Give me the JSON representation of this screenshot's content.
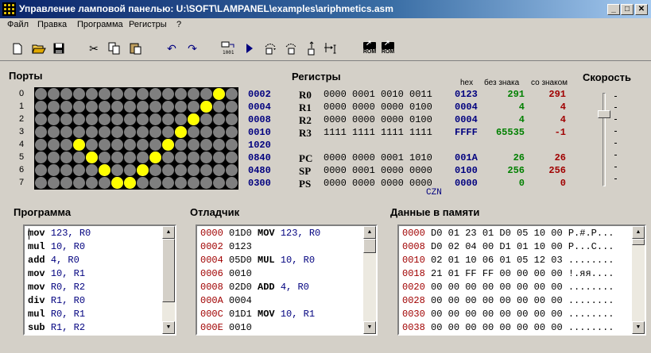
{
  "window": {
    "title": "Управление ламповой панелью: U:\\SOFT\\LAMPANEL\\examples\\ariphmetics.asm",
    "min": "_",
    "max": "□",
    "close": "✕"
  },
  "menu": [
    "Файл",
    "Правка",
    "Программа",
    "Регистры",
    "?"
  ],
  "toolbar": {
    "icons": [
      "new-file-icon",
      "open-folder-icon",
      "save-icon",
      "cut-icon",
      "copy-icon",
      "paste-icon",
      "undo-icon",
      "redo-icon",
      "compile-icon",
      "run-icon",
      "step-into-icon",
      "step-over-icon",
      "step-out-icon",
      "run-to-cursor-icon",
      "load-rom-icon",
      "save-rom-icon"
    ],
    "rom_labels": [
      "ROM",
      "ROM"
    ]
  },
  "ports": {
    "title": "Порты",
    "rows": [
      {
        "num": "0",
        "value": "0002",
        "bits": [
          0,
          0,
          0,
          0,
          0,
          0,
          0,
          0,
          0,
          0,
          0,
          0,
          0,
          0,
          1,
          0
        ]
      },
      {
        "num": "1",
        "value": "0004",
        "bits": [
          0,
          0,
          0,
          0,
          0,
          0,
          0,
          0,
          0,
          0,
          0,
          0,
          0,
          1,
          0,
          0
        ]
      },
      {
        "num": "2",
        "value": "0008",
        "bits": [
          0,
          0,
          0,
          0,
          0,
          0,
          0,
          0,
          0,
          0,
          0,
          0,
          1,
          0,
          0,
          0
        ]
      },
      {
        "num": "3",
        "value": "0010",
        "bits": [
          0,
          0,
          0,
          0,
          0,
          0,
          0,
          0,
          0,
          0,
          0,
          1,
          0,
          0,
          0,
          0
        ]
      },
      {
        "num": "4",
        "value": "1020",
        "bits": [
          0,
          0,
          0,
          1,
          0,
          0,
          0,
          0,
          0,
          0,
          1,
          0,
          0,
          0,
          0,
          0
        ]
      },
      {
        "num": "5",
        "value": "0840",
        "bits": [
          0,
          0,
          0,
          0,
          1,
          0,
          0,
          0,
          0,
          1,
          0,
          0,
          0,
          0,
          0,
          0
        ]
      },
      {
        "num": "6",
        "value": "0480",
        "bits": [
          0,
          0,
          0,
          0,
          0,
          1,
          0,
          0,
          1,
          0,
          0,
          0,
          0,
          0,
          0,
          0
        ]
      },
      {
        "num": "7",
        "value": "0300",
        "bits": [
          0,
          0,
          0,
          0,
          0,
          0,
          1,
          1,
          0,
          0,
          0,
          0,
          0,
          0,
          0,
          0
        ]
      }
    ]
  },
  "registers": {
    "title": "Регистры",
    "headers": {
      "hex": "hex",
      "unsigned": "без знака",
      "signed": "со знаком"
    },
    "rows": [
      {
        "name": "R0",
        "bin": "0000 0001 0010 0011",
        "hex": "0123",
        "unsigned": "291",
        "signed": "291"
      },
      {
        "name": "R1",
        "bin": "0000 0000 0000 0100",
        "hex": "0004",
        "unsigned": "4",
        "signed": "4"
      },
      {
        "name": "R2",
        "bin": "0000 0000 0000 0100",
        "hex": "0004",
        "unsigned": "4",
        "signed": "4"
      },
      {
        "name": "R3",
        "bin": "1111 1111 1111 1111",
        "hex": "FFFF",
        "unsigned": "65535",
        "signed": "-1"
      },
      {
        "name": "PC",
        "bin": "0000 0000 0001 1010",
        "hex": "001A",
        "unsigned": "26",
        "signed": "26"
      },
      {
        "name": "SP",
        "bin": "0000 0001 0000 0000",
        "hex": "0100",
        "unsigned": "256",
        "signed": "256"
      },
      {
        "name": "PS",
        "bin": "0000 0000 0000 0000",
        "hex": "0000",
        "unsigned": "0",
        "signed": "0"
      }
    ],
    "flags": "CZN"
  },
  "speed": {
    "title": "Скорость",
    "level": 0.2
  },
  "program": {
    "title": "Программа",
    "lines": [
      {
        "op": "mov",
        "args": "123, R0"
      },
      {
        "op": "mul",
        "args": "10, R0"
      },
      {
        "op": "add",
        "args": "4, R0"
      },
      {
        "op": "mov",
        "args": "10, R1"
      },
      {
        "op": "mov",
        "args": "R0, R2"
      },
      {
        "op": "div",
        "args": "R1, R0"
      },
      {
        "op": "mul",
        "args": "R0, R1"
      },
      {
        "op": "sub",
        "args": "R1, R2"
      }
    ]
  },
  "debugger": {
    "title": "Отладчик",
    "lines": [
      {
        "addr": "0000",
        "code": "01D0",
        "op": "MOV",
        "args": "123, R0"
      },
      {
        "addr": "0002",
        "code": "0123",
        "op": "",
        "args": ""
      },
      {
        "addr": "0004",
        "code": "05D0",
        "op": "MUL",
        "args": "10, R0"
      },
      {
        "addr": "0006",
        "code": "0010",
        "op": "",
        "args": ""
      },
      {
        "addr": "0008",
        "code": "02D0",
        "op": "ADD",
        "args": "4, R0"
      },
      {
        "addr": "000A",
        "code": "0004",
        "op": "",
        "args": ""
      },
      {
        "addr": "000C",
        "code": "01D1",
        "op": "MOV",
        "args": "10, R1"
      },
      {
        "addr": "000E",
        "code": "0010",
        "op": "",
        "args": ""
      }
    ]
  },
  "memory": {
    "title": "Данные в памяти",
    "lines": [
      {
        "addr": "0000",
        "bytes": "D0 01 23 01 D0 05 10 00",
        "ascii": "P.#.P..."
      },
      {
        "addr": "0008",
        "bytes": "D0 02 04 00 D1 01 10 00",
        "ascii": "P...C..."
      },
      {
        "addr": "0010",
        "bytes": "02 01 10 06 01 05 12 03",
        "ascii": "........"
      },
      {
        "addr": "0018",
        "bytes": "21 01 FF FF 00 00 00 00",
        "ascii": "!.яя...."
      },
      {
        "addr": "0020",
        "bytes": "00 00 00 00 00 00 00 00",
        "ascii": "........"
      },
      {
        "addr": "0028",
        "bytes": "00 00 00 00 00 00 00 00",
        "ascii": "........"
      },
      {
        "addr": "0030",
        "bytes": "00 00 00 00 00 00 00 00",
        "ascii": "........"
      },
      {
        "addr": "0038",
        "bytes": "00 00 00 00 00 00 00 00",
        "ascii": "........"
      }
    ]
  }
}
